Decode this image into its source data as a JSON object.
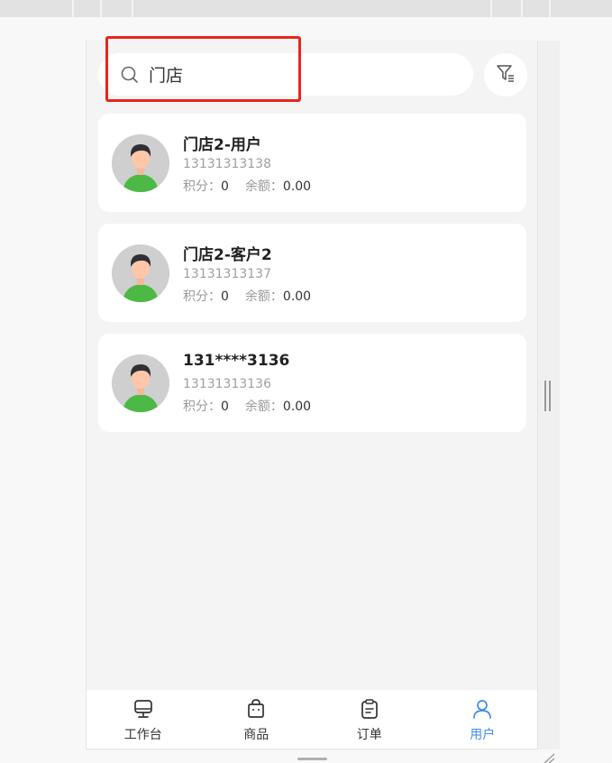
{
  "search": {
    "icon": "search-icon",
    "value": "门店"
  },
  "filter": {
    "icon": "filter-icon"
  },
  "users": [
    {
      "name": "门店2-用户",
      "phone": "13131313138",
      "points_label": "积分：",
      "points": "0",
      "balance_label": "余额：",
      "balance": "0.00"
    },
    {
      "name": "门店2-客户2",
      "phone": "13131313137",
      "points_label": "积分：",
      "points": "0",
      "balance_label": "余额：",
      "balance": "0.00"
    },
    {
      "name": "131****3136",
      "phone": "13131313136",
      "points_label": "积分：",
      "points": "0",
      "balance_label": "余额：",
      "balance": "0.00"
    }
  ],
  "tabbar": {
    "tabs": [
      {
        "label": "工作台",
        "icon": "monitor-icon",
        "active": false
      },
      {
        "label": "商品",
        "icon": "bag-icon",
        "active": false
      },
      {
        "label": "订单",
        "icon": "clipboard-icon",
        "active": false
      },
      {
        "label": "用户",
        "icon": "user-icon",
        "active": true
      }
    ]
  },
  "colors": {
    "accent": "#3f8ee8",
    "highlight": "#e8261c",
    "avatar_shirt": "#4cb944",
    "avatar_bg": "#cfcfcf"
  }
}
